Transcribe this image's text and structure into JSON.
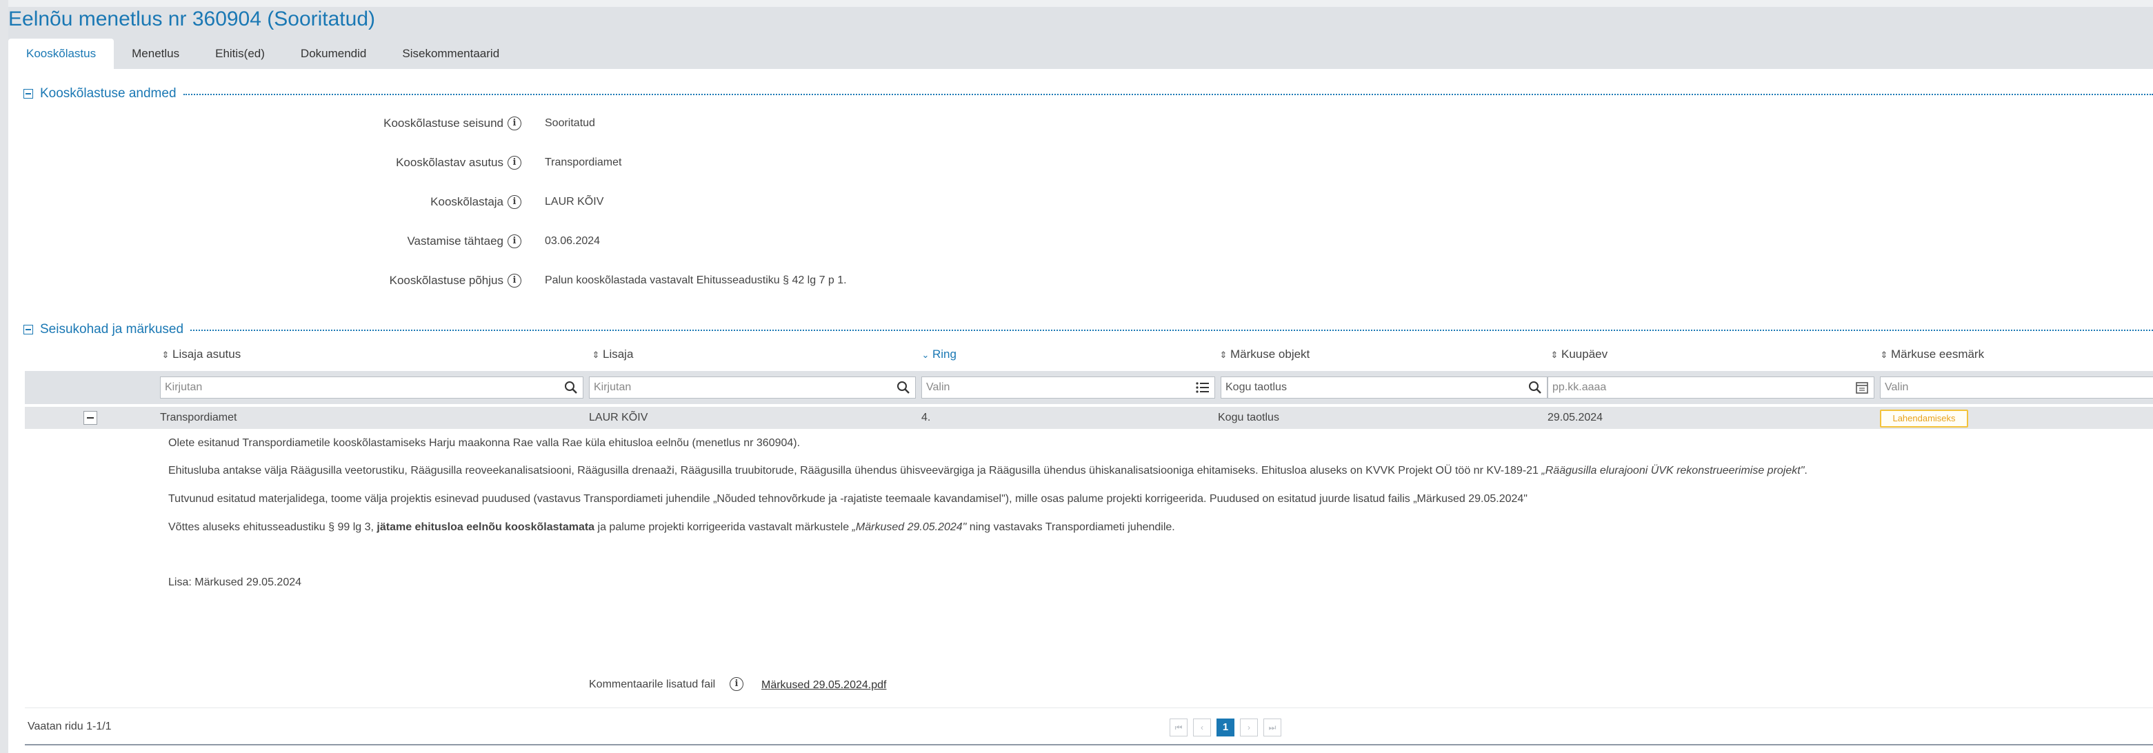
{
  "page": {
    "title": "Eelnõu menetlus nr 360904 (Sooritatud)"
  },
  "tabs": [
    {
      "label": "Kooskõlastus",
      "active": true
    },
    {
      "label": "Menetlus",
      "active": false
    },
    {
      "label": "Ehitis(ed)",
      "active": false
    },
    {
      "label": "Dokumendid",
      "active": false
    },
    {
      "label": "Sisekommentaarid",
      "active": false
    }
  ],
  "section1": {
    "title": "Kooskõlastuse andmed",
    "fields": [
      {
        "label": "Kooskõlastuse seisund",
        "value": "Sooritatud"
      },
      {
        "label": "Kooskõlastav asutus",
        "value": "Transpordiamet"
      },
      {
        "label": "Kooskõlastaja",
        "value": "LAUR KÕIV"
      },
      {
        "label": "Vastamise tähtaeg",
        "value": "03.06.2024"
      },
      {
        "label": "Kooskõlastuse põhjus",
        "value": "Palun kooskõlastada vastavalt Ehitusseadustiku § 42 lg 7 p 1."
      }
    ]
  },
  "section2": {
    "title": "Seisukohad ja märkused"
  },
  "table": {
    "columns": [
      {
        "label": "Lisaja asutus",
        "sort": "none"
      },
      {
        "label": "Lisaja",
        "sort": "none"
      },
      {
        "label": "Ring",
        "sort": "desc"
      },
      {
        "label": "Märkuse objekt",
        "sort": "none"
      },
      {
        "label": "Kuupäev",
        "sort": "none"
      },
      {
        "label": "Märkuse eesmärk",
        "sort": "none"
      }
    ],
    "filters": [
      {
        "placeholder": "Kirjutan",
        "value": "",
        "icon": "search-icon"
      },
      {
        "placeholder": "Kirjutan",
        "value": "",
        "icon": "search-icon"
      },
      {
        "placeholder": "Valin",
        "value": "",
        "icon": "list-icon"
      },
      {
        "placeholder": "",
        "value": "Kogu taotlus",
        "icon": "search-icon"
      },
      {
        "placeholder": "pp.kk.aaaa",
        "value": "",
        "icon": "calendar-icon"
      },
      {
        "placeholder": "Valin",
        "value": "",
        "icon": ""
      }
    ],
    "row": {
      "asutus": "Transpordiamet",
      "lisaja": "LAUR KÕIV",
      "ring": "4.",
      "objekt": "Kogu taotlus",
      "kuupaev": "29.05.2024",
      "eesmark": "Lahendamiseks"
    },
    "detail": {
      "p1": "Olete esitanud Transpordiametile kooskõlastamiseks Harju maakonna Rae valla Rae küla ehitusloa eelnõu (menetlus nr 360904).",
      "p2_text": "Ehitusluba antakse välja Räägusilla veetorustiku, Räägusilla reoveekanalisatsiooni, Räägusilla drenaaži, Räägusilla truubitorude, Räägusilla ühendus ühisveevärgiga ja Räägusilla ühendus ühiskanalisatsiooniga ehitamiseks. Ehitusloa aluseks on KVVK Projekt OÜ töö nr KV-189-21 ",
      "p2_italic": "„Räägusilla elurajooni ÜVK rekonstrueerimise projekt\"",
      "p2_end": ".",
      "p3": "Tutvunud esitatud materjalidega, toome välja projektis esinevad puudused (vastavus Transpordiameti juhendile „Nõuded tehnovõrkude ja -rajatiste teemaale kavandamisel\"), mille osas palume projekti korrigeerida. Puudused on esitatud juurde lisatud failis „Märkused 29.05.2024\"",
      "p4_start": "Võttes aluseks ehitusseadustiku § 99 lg 3, ",
      "p4_bold": "jätame ehitusloa eelnõu kooskõlastamata",
      "p4_mid": " ja palume projekti korrigeerida vastavalt märkustele ",
      "p4_italic": "„Märkused 29.05.2024\"",
      "p4_end": " ning vastavaks Transpordiameti juhendile.",
      "lisa": "Lisa: Märkused 29.05.2024"
    },
    "attachment": {
      "label": "Kommentaarile lisatud fail",
      "file": "Märkused 29.05.2024.pdf"
    }
  },
  "footer": {
    "rows_text": "Vaatan ridu 1-1/1",
    "pages": {
      "first": "⏮",
      "prev": "‹",
      "current": "1",
      "next": "›",
      "last": "⏭"
    }
  },
  "colors": {
    "accent": "#1a78b4",
    "badge_border": "#f3c33a",
    "badge_text": "#e8a21a"
  }
}
